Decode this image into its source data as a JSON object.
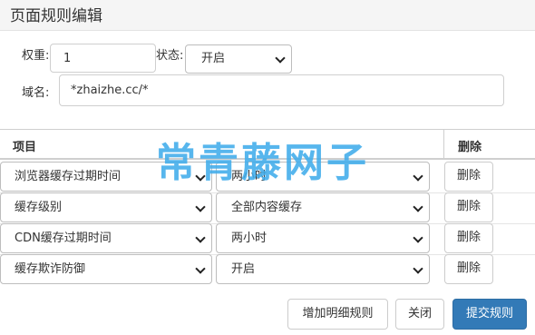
{
  "header": {
    "title": "页面规则编辑"
  },
  "form": {
    "weight_label": "权重:",
    "weight_value": "1",
    "status_label": "状态:",
    "status_value": "开启",
    "domain_label": "域名:",
    "domain_value": "*zhaizhe.cc/*"
  },
  "table": {
    "col_item": "项目",
    "col_delete": "删除",
    "rows": [
      {
        "item": "浏览器缓存过期时间",
        "value": "两小时",
        "delete": "删除"
      },
      {
        "item": "缓存级别",
        "value": "全部内容缓存",
        "delete": "删除"
      },
      {
        "item": "CDN缓存过期时间",
        "value": "两小时",
        "delete": "删除"
      },
      {
        "item": "缓存欺诈防御",
        "value": "开启",
        "delete": "删除"
      }
    ]
  },
  "footer": {
    "add_label": "增加明细规则",
    "close_label": "关闭",
    "submit_label": "提交规则"
  },
  "watermark": "常青藤网子",
  "colors": {
    "primary": "#337ab7",
    "watermark": "#40acea"
  }
}
